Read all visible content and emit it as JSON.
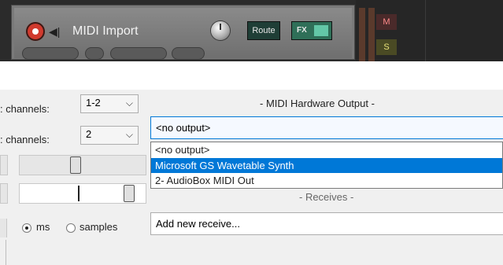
{
  "track": {
    "name": "MIDI Import",
    "route_label": "Route",
    "fx_label": "FX",
    "mute_label": "M",
    "solo_label": "S"
  },
  "hardware_output": {
    "title": "- MIDI Hardware Output -",
    "selected": "<no output>",
    "options": [
      "<no output>",
      "Microsoft GS Wavetable Synth",
      "2- AudioBox MIDI Out"
    ],
    "highlighted_index": 1
  },
  "receives": {
    "title": "- Receives -",
    "add_label": "Add new receive..."
  },
  "channels": {
    "label_1": ": channels:",
    "value_1": "1-2",
    "label_2": ": channels:",
    "value_2": "2"
  },
  "units": {
    "ms_label": "ms",
    "samples_label": "samples",
    "selected": "ms"
  },
  "colors": {
    "accent": "#0078d7",
    "arm": "#d03a2e",
    "fx": "#2f6f58"
  }
}
